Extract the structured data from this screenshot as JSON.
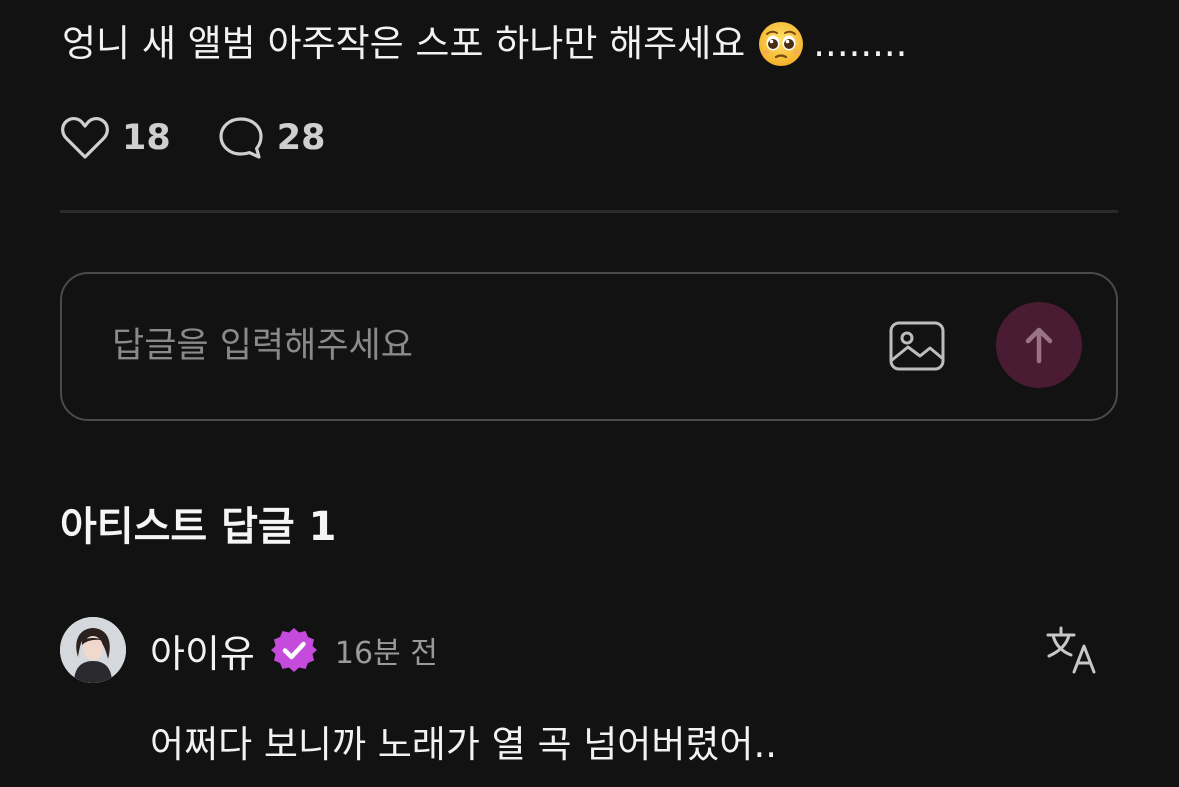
{
  "post": {
    "text": "엉니 새 앨범 아주작은 스포 하나만 해주세요",
    "emoji_name": "pleading-face-emoji",
    "trailing": "........",
    "like_count": "18",
    "comment_count": "28"
  },
  "reply_box": {
    "placeholder": "답글을 입력해주세요",
    "image_icon": "image-icon",
    "send_icon": "arrow-up-icon"
  },
  "artist_replies": {
    "title": "아티스트 답글 1",
    "items": [
      {
        "author": "아이유",
        "verified": true,
        "time": "16분 전",
        "text": "어쩌다 보니까 노래가 열 곡 넘어버렸어.."
      }
    ]
  },
  "colors": {
    "background": "#121212",
    "accent_send": "#4a1c33",
    "verified_badge": "#c54bdc"
  }
}
